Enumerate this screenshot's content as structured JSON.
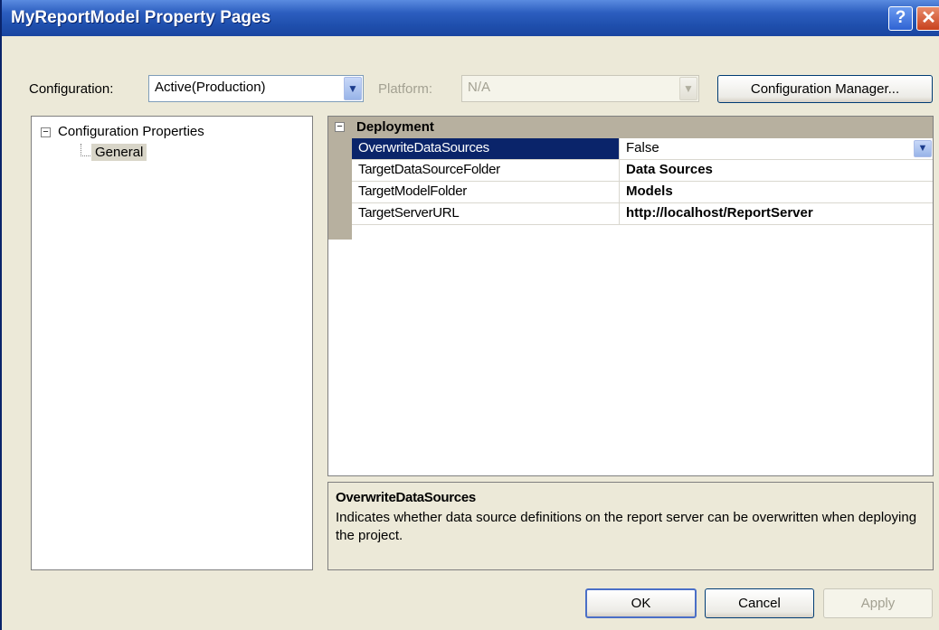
{
  "window": {
    "title": "MyReportModel Property Pages",
    "help_glyph": "?",
    "close_glyph": "✕"
  },
  "toolbar": {
    "configuration_label": "Configuration:",
    "configuration_value": "Active(Production)",
    "platform_label": "Platform:",
    "platform_value": "N/A",
    "config_manager_button": "Configuration Manager..."
  },
  "tree": {
    "root_expander": "−",
    "root": "Configuration Properties",
    "child": "General"
  },
  "grid": {
    "category_expander": "−",
    "category": "Deployment",
    "rows": [
      {
        "name": "OverwriteDataSources",
        "value": "False"
      },
      {
        "name": "TargetDataSourceFolder",
        "value": "Data Sources"
      },
      {
        "name": "TargetModelFolder",
        "value": "Models"
      },
      {
        "name": "TargetServerURL",
        "value": "http://localhost/ReportServer"
      }
    ]
  },
  "description": {
    "title": "OverwriteDataSources",
    "text": "Indicates whether data source definitions on the report server can be overwritten when deploying the project."
  },
  "buttons": {
    "ok": "OK",
    "cancel": "Cancel",
    "apply": "Apply"
  },
  "icons": {
    "dropdown": "chevron-down-icon"
  }
}
